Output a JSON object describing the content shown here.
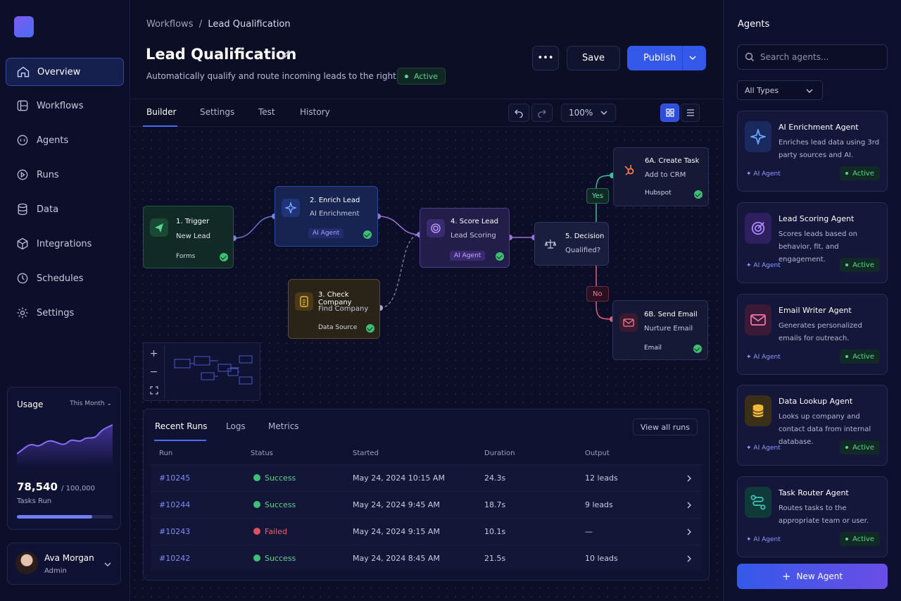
{
  "nav": {
    "items": [
      {
        "label": "Overview",
        "icon": "home-icon",
        "active": true
      },
      {
        "label": "Workflows",
        "icon": "workflow-icon"
      },
      {
        "label": "Agents",
        "icon": "agent-icon"
      },
      {
        "label": "Runs",
        "icon": "play-icon"
      },
      {
        "label": "Data",
        "icon": "database-icon"
      },
      {
        "label": "Integrations",
        "icon": "cube-icon"
      },
      {
        "label": "Schedules",
        "icon": "clock-icon"
      },
      {
        "label": "Settings",
        "icon": "gear-icon"
      }
    ]
  },
  "usage": {
    "title": "Usage",
    "period": "This Month",
    "value": "78,540",
    "limit": "/ 100,000",
    "label": "Tasks Run",
    "progress": 0.7854
  },
  "user": {
    "name": "Ava Morgan",
    "role": "Admin"
  },
  "breadcrumb": {
    "parent": "Workflows",
    "sep": "/",
    "current": "Lead Qualification"
  },
  "header": {
    "title": "Lead Qualification",
    "description": "Automatically qualify and route incoming leads to the right team.",
    "status": "Active",
    "more": "•••",
    "save": "Save",
    "publish": "Publish"
  },
  "tabs": [
    "Builder",
    "Settings",
    "Test",
    "History"
  ],
  "zoom": "100%",
  "workflow": {
    "nodes": [
      {
        "title": "1. Trigger",
        "subtitle": "New Lead",
        "footer": "Forms"
      },
      {
        "title": "2. Enrich Lead",
        "subtitle": "AI Enrichment",
        "tag": "AI Agent"
      },
      {
        "title": "3. Check Company",
        "subtitle": "Find Company",
        "footer": "Data Source"
      },
      {
        "title": "4. Score Lead",
        "subtitle": "Lead Scoring",
        "tag": "AI Agent"
      },
      {
        "title": "5. Decision",
        "subtitle": "Qualified?"
      },
      {
        "title": "6A. Create Task",
        "subtitle": "Add to CRM",
        "footer": "Hubspot"
      },
      {
        "title": "6B. Send Email",
        "subtitle": "Nurture Email",
        "footer": "Email"
      }
    ],
    "yes": "Yes",
    "no": "No"
  },
  "minimap": {
    "zoom_in": "+",
    "zoom_out": "−"
  },
  "runs": {
    "tabs": [
      "Recent Runs",
      "Logs",
      "Metrics"
    ],
    "view_all": "View all runs",
    "columns": [
      "Run",
      "Status",
      "Started",
      "Duration",
      "Output"
    ],
    "rows": [
      {
        "id": "#10245",
        "status": "Success",
        "started": "May 24, 2024 10:15 AM",
        "duration": "24.3s",
        "output": "12 leads"
      },
      {
        "id": "#10244",
        "status": "Success",
        "started": "May 24, 2024  9:45 AM",
        "duration": "18.7s",
        "output": "9 leads"
      },
      {
        "id": "#10243",
        "status": "Failed",
        "started": "May 24, 2024  9:15 AM",
        "duration": "10.1s",
        "output": "—"
      },
      {
        "id": "#10242",
        "status": "Success",
        "started": "May 24, 2024  8:45 AM",
        "duration": "21.5s",
        "output": "10 leads"
      }
    ]
  },
  "agents_panel": {
    "title": "Agents",
    "search_placeholder": "Search agents...",
    "filter": "All Types",
    "agents": [
      {
        "name": "AI Enrichment Agent",
        "desc": "Enriches lead data using 3rd party sources and AI.",
        "type": "AI Agent",
        "status": "Active",
        "color": "#4a8cf7"
      },
      {
        "name": "Lead Scoring Agent",
        "desc": "Scores leads based on behavior, fit, and engagement.",
        "type": "AI Agent",
        "status": "Active",
        "color": "#9b6cf7"
      },
      {
        "name": "Email Writer Agent",
        "desc": "Generates personalized emails for outreach.",
        "type": "AI Agent",
        "status": "Active",
        "color": "#e060a0"
      },
      {
        "name": "Data Lookup Agent",
        "desc": "Looks up company and contact data from internal database.",
        "type": "AI Agent",
        "status": "Active",
        "color": "#f0b838"
      },
      {
        "name": "Task Router Agent",
        "desc": "Routes tasks to the appropriate team or user.",
        "type": "AI Agent",
        "status": "Active",
        "color": "#3fc9c0"
      }
    ],
    "new_agent": "New Agent"
  }
}
